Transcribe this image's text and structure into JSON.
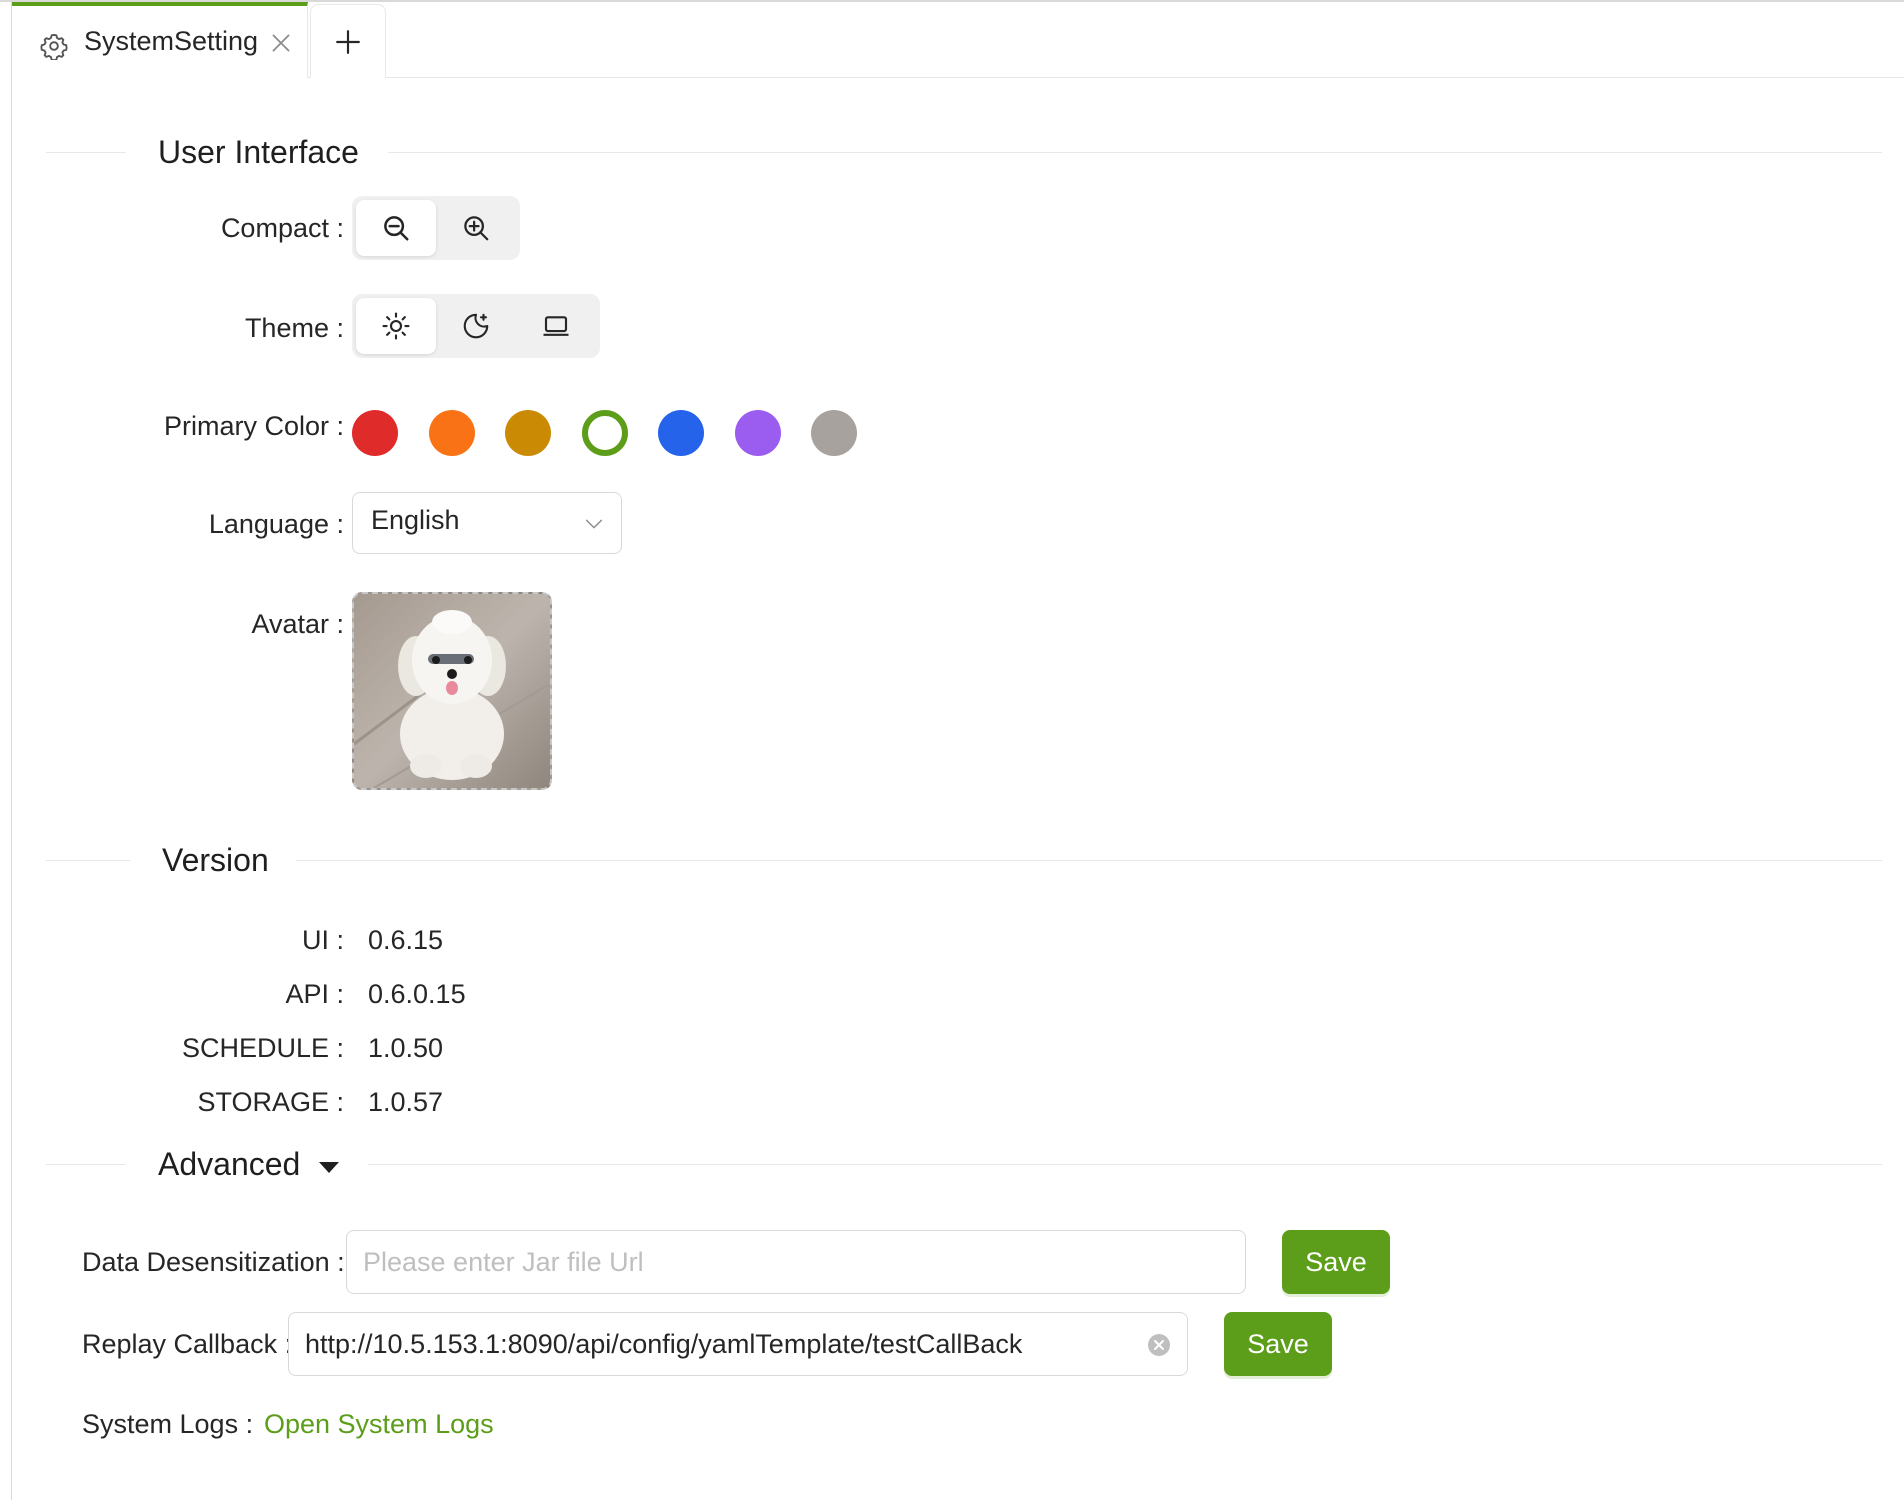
{
  "tabs": [
    {
      "label": "SystemSetting",
      "icon": "gear-icon",
      "active": true
    }
  ],
  "add_tab_icon": "plus-icon",
  "accent_color": "#5c9e1a",
  "user_interface": {
    "title": "User Interface",
    "compact_label": "Compact",
    "compact_options": [
      "zoom-out-icon",
      "zoom-in-icon"
    ],
    "compact_selected": 0,
    "theme_label": "Theme",
    "theme_options": [
      "sun-icon",
      "moon-icon",
      "laptop-icon"
    ],
    "theme_selected": 0,
    "primary_color_label": "Primary Color",
    "primary_colors": [
      "#e02b2b",
      "#f97316",
      "#ca8a04",
      "#5c9e1a",
      "#2563eb",
      "#9b5cf0",
      "#a8a29e"
    ],
    "primary_color_selected": 3,
    "language_label": "Language",
    "language_value": "English",
    "avatar_label": "Avatar"
  },
  "version": {
    "title": "Version",
    "items": [
      {
        "label": "UI",
        "value": "0.6.15"
      },
      {
        "label": "API",
        "value": "0.6.0.15"
      },
      {
        "label": "SCHEDULE",
        "value": "1.0.50"
      },
      {
        "label": "STORAGE",
        "value": "1.0.57"
      }
    ]
  },
  "advanced": {
    "title": "Advanced",
    "desensitization_label": "Data Desensitization",
    "desensitization_placeholder": "Please enter Jar file Url",
    "desensitization_value": "",
    "replay_callback_label": "Replay Callback",
    "replay_callback_value": "http://10.5.153.1:8090/api/config/yamlTemplate/testCallBack",
    "save_label": "Save",
    "system_logs_label": "System Logs",
    "system_logs_link": "Open System Logs"
  }
}
